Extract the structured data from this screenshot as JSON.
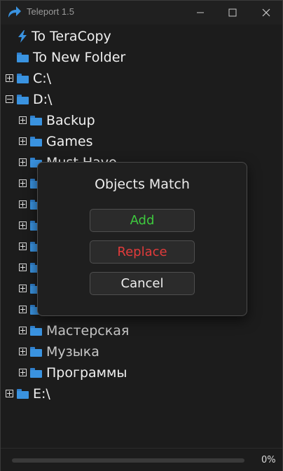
{
  "window": {
    "title": "Teleport 1.5",
    "icons": {
      "app": "share-arrow-icon",
      "minimize": "minimize-icon",
      "maximize": "maximize-icon",
      "close": "close-icon"
    }
  },
  "tree": {
    "items": [
      {
        "label": "To TeraCopy",
        "icon": "bolt-icon"
      },
      {
        "label": "To New Folder",
        "icon": "folder-icon"
      },
      {
        "label": "C:\\",
        "icon": "folder-icon",
        "expander": "plus"
      },
      {
        "label": "D:\\",
        "icon": "folder-icon",
        "expander": "minus"
      },
      {
        "label": "Backup",
        "icon": "folder-icon",
        "expander": "plus"
      },
      {
        "label": "Games",
        "icon": "folder-icon",
        "expander": "plus"
      },
      {
        "label": "Must Have",
        "icon": "folder-icon",
        "expander": "plus"
      },
      {
        "label": "Мастерская",
        "icon": "folder-icon",
        "expander": "plus"
      },
      {
        "label": "Музыка",
        "icon": "folder-icon",
        "expander": "plus"
      },
      {
        "label": "Программы",
        "icon": "folder-icon",
        "expander": "plus"
      },
      {
        "label": "E:\\",
        "icon": "folder-icon",
        "expander": "plus"
      }
    ]
  },
  "dialog": {
    "title": "Objects Match",
    "add_label": "Add",
    "replace_label": "Replace",
    "cancel_label": "Cancel"
  },
  "status": {
    "progress_percent": 0,
    "progress_label": "0%"
  },
  "colors": {
    "accent": "#3a93e0",
    "add_green": "#3ec93e",
    "replace_red": "#e23b3b"
  }
}
